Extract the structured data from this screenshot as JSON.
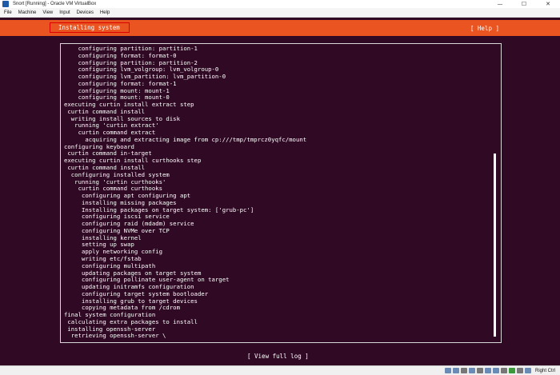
{
  "window": {
    "title": "Snort [Running] - Oracle VM VirtualBox",
    "controls": [
      "—",
      "☐",
      "✕"
    ]
  },
  "menubar": {
    "items": [
      "File",
      "Machine",
      "View",
      "Input",
      "Devices",
      "Help"
    ]
  },
  "installer": {
    "heading": "Installing system",
    "help_label": "[ Help ]",
    "full_log_label": "[ View full log ]",
    "log_lines": [
      "    configuring partition: partition-1",
      "    configuring format: format-0",
      "    configuring partition: partition-2",
      "    configuring lvm_volgroup: lvm_volgroup-0",
      "    configuring lvm_partition: lvm_partition-0",
      "    configuring format: format-1",
      "    configuring mount: mount-1",
      "    configuring mount: mount-0",
      "executing curtin install extract step",
      " curtin command install",
      "  writing install sources to disk",
      "   running 'curtin extract'",
      "    curtin command extract",
      "      acquiring and extracting image from cp:///tmp/tmprcz0yqfc/mount",
      "configuring keyboard",
      " curtin command in-target",
      "executing curtin install curthooks step",
      " curtin command install",
      "  configuring installed system",
      "   running 'curtin curthooks'",
      "    curtin command curthooks",
      "     configuring apt configuring apt",
      "     installing missing packages",
      "     Installing packages on target system: ['grub-pc']",
      "     configuring iscsi service",
      "     configuring raid (mdadm) service",
      "     configuring NVMe over TCP",
      "     installing kernel",
      "     setting up swap",
      "     apply networking config",
      "     writing etc/fstab",
      "     configuring multipath",
      "     updating packages on target system",
      "     configuring pollinate user-agent on target",
      "     updating initramfs configuration",
      "     configuring target system bootloader",
      "     installing grub to target devices",
      "     copying metadata from /cdrom",
      "final system configuration",
      " calculating extra packages to install",
      " installing openssh-server",
      "  retrieving openssh-server \\"
    ]
  },
  "statusbar": {
    "icons": [
      "hard-disk-icon",
      "optical-drive-icon",
      "audio-icon",
      "network-icon",
      "usb-icon",
      "shared-folders-icon",
      "display-icon",
      "video-capture-icon",
      "mouse-integration-icon",
      "keyboard-icon",
      "cpu-icon"
    ],
    "host_key": "Right Ctrl"
  },
  "colors": {
    "orange_bar": "#e95420",
    "background": "#300a24",
    "text": "#ffffff",
    "highlight_box": "#dd0000"
  }
}
